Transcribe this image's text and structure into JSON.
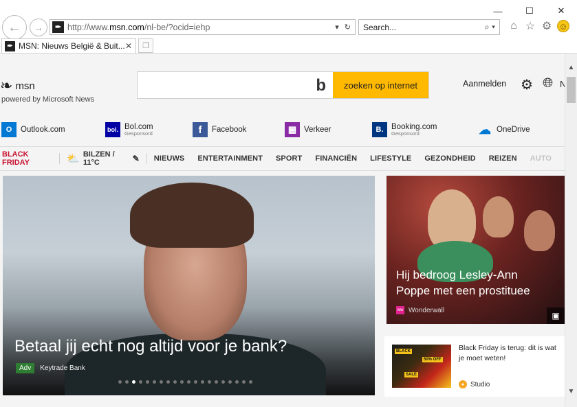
{
  "browser": {
    "window_controls": [
      "—",
      "☐",
      "✕"
    ],
    "address_host_prefix": "http://www.",
    "address_host": "msn.com",
    "address_path": "/nl-be/?ocid=iehp",
    "search_placeholder": "Search...",
    "tab_title": "MSN: Nieuws België & Buit...",
    "tab_close": "✕"
  },
  "header": {
    "logo_text": "msn",
    "powered_by": "powered by Microsoft News",
    "search_button": "zoeken op internet",
    "sign_in": "Aanmelden",
    "lang": "N"
  },
  "quick_links": [
    {
      "label": "Outlook.com",
      "sub": "",
      "icon": "outlook-icon",
      "color": "#0078d4"
    },
    {
      "label": "Bol.com",
      "sub": "Gesponsord",
      "icon": "bol-icon",
      "color": "#0000a4"
    },
    {
      "label": "Facebook",
      "sub": "",
      "icon": "facebook-icon",
      "color": "#3b5998"
    },
    {
      "label": "Verkeer",
      "sub": "",
      "icon": "map-icon",
      "color": "#8a2aa5"
    },
    {
      "label": "Booking.com",
      "sub": "Gesponsord",
      "icon": "booking-icon",
      "color": "#003580"
    },
    {
      "label": "OneDrive",
      "sub": "",
      "icon": "onedrive-icon",
      "color": "#0078d4"
    }
  ],
  "nav": {
    "black_friday": "BLACK FRIDAY",
    "weather": "BILZEN / 11°C",
    "items": [
      "NIEUWS",
      "ENTERTAINMENT",
      "SPORT",
      "FINANCIËN",
      "LIFESTYLE",
      "GEZONDHEID",
      "REIZEN",
      "AUTO"
    ]
  },
  "hero": {
    "title": "Betaal jij echt nog altijd voor je bank?",
    "badge": "Adv",
    "source": "Keytrade Bank",
    "dot_count": 20,
    "active_dot": 2
  },
  "side_story": {
    "title": "Hij bedroog Lesley-Ann Poppe met een prostituee",
    "source": "Wonderwall",
    "source_badge": "ww"
  },
  "bf_story": {
    "title": "Black Friday is terug: dit is wat je moet weten!",
    "source": "Studio",
    "thumb_tags": [
      "BLACK",
      "50% OFF",
      "SALE"
    ]
  },
  "colors": {
    "accent": "#ffb900",
    "black_friday": "#c8102e",
    "adv_badge": "#2e7d32"
  }
}
